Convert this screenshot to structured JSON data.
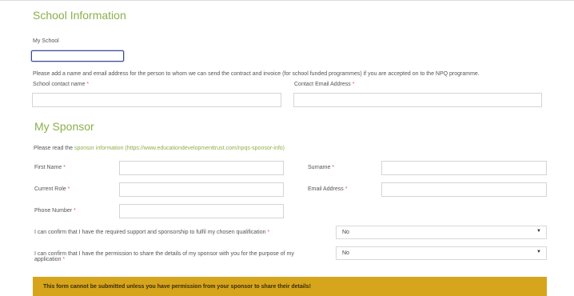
{
  "school": {
    "title": "School Information",
    "my_school_label": "My School",
    "my_school_value": "",
    "notice": "Please add a name and email address for the person to whom we can send the contract and invoice (for school funded programmes) if you are accepted on to the NPQ programme.",
    "contact_name_label": "School contact name",
    "contact_email_label": "Contact Email Address",
    "required_mark": "*"
  },
  "sponsor": {
    "title": "My Sponsor",
    "read_prefix": "Please read the ",
    "read_link": "sponsor information",
    "read_url": "(https://www.educationdevelopmenttrust.com/npqs-sponsor-info)",
    "first_name_label": "First Name",
    "surname_label": "Surname",
    "current_role_label": "Current Role",
    "email_label": "Email Address",
    "phone_label": "Phone Number",
    "confirm_support_label": "I can confirm that I have the required support and sponsorship to fulfil my chosen qualification",
    "confirm_support_value": "No",
    "confirm_permission_label_line1": "I can confirm that I have the permission to share the details of my sponsor with you for the purpose of my",
    "confirm_permission_label_line2": "application",
    "confirm_permission_value": "No",
    "warning": "This form cannot be submitted unless you have permission from your sponsor to share their details!"
  },
  "icons": {
    "dropdown": "chevron-down-icon"
  },
  "colors": {
    "accent": "#8bb04a",
    "required": "#e0557a",
    "warning_bg": "#d6a51b",
    "focus_border": "#3d4a8f"
  }
}
